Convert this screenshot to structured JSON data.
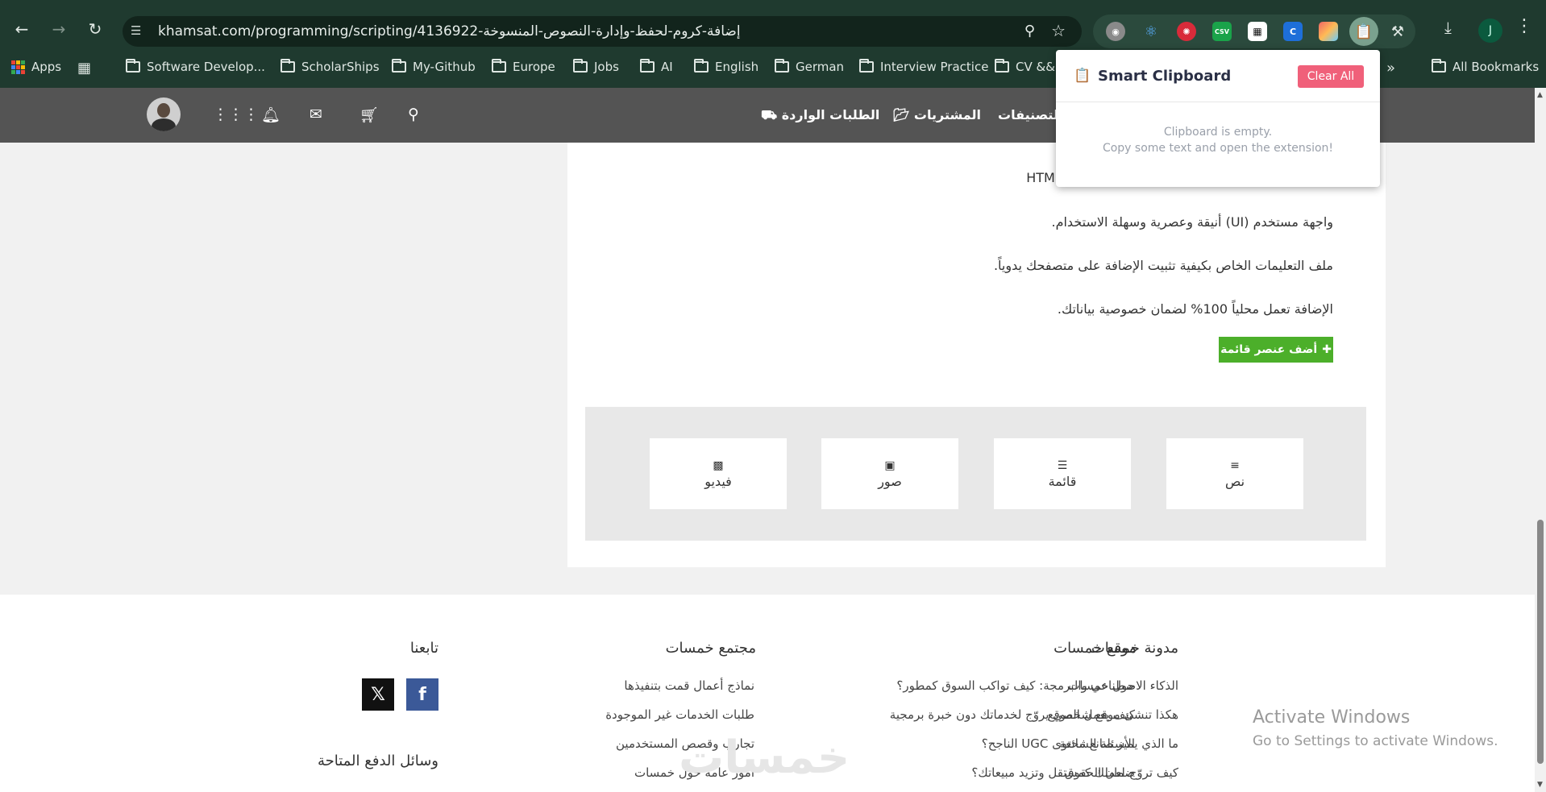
{
  "browser": {
    "url": "khamsat.com/programming/scripting/4136922-إضافة-كروم-لحفظ-وإدارة-النصوص-المنسوخة",
    "profile_initial": "J",
    "bookmarks": [
      {
        "label": "Apps"
      },
      {
        "label": "Software Develop..."
      },
      {
        "label": "ScholarShips"
      },
      {
        "label": "My-Github"
      },
      {
        "label": "Europe"
      },
      {
        "label": "Jobs"
      },
      {
        "label": "AI"
      },
      {
        "label": "English"
      },
      {
        "label": "German"
      },
      {
        "label": "Interview Practice"
      },
      {
        "label": "CV &&"
      }
    ],
    "all_bookmarks": "All Bookmarks",
    "overflow": "»"
  },
  "popup": {
    "title": "Smart Clipboard",
    "clear_label": "Clear All",
    "empty_line1": "Clipboard is empty.",
    "empty_line2": "Copy some text and open the extension!"
  },
  "sitenav": {
    "incoming_orders": "الطلبات الواردة",
    "purchases": "المشتريات",
    "categories": "التصنيفات"
  },
  "content": {
    "partial_line": "(HTML",
    "lines": [
      "واجهة مستخدم (UI) أنيقة وعصرية وسهلة الاستخدام.",
      "ملف التعليمات الخاص بكيفية تثبيت الإضافة على متصفحك يدوياً.",
      "الإضافة تعمل محلياً 100% لضمان خصوصية بياناتك."
    ],
    "add_list_item": "أضف عنصر قائمة",
    "blocks": [
      {
        "label": "نص",
        "icon": "text-align-icon"
      },
      {
        "label": "قائمة",
        "icon": "list-icon"
      },
      {
        "label": "صور",
        "icon": "image-icon"
      },
      {
        "label": "فيديو",
        "icon": "video-file-icon"
      }
    ]
  },
  "footer": {
    "site_title": "موقع خمسات",
    "site_links": [
      "حول خمسات",
      "كيف يعمل الموقع",
      "الأسئلة الشائعة",
      "ضمان الحقوق"
    ],
    "blog_title": "مدونة خمسات",
    "blog_links": [
      "الذكاء الاصطناعي والبرمجة: كيف تواكب السوق كمطور؟",
      "هكذا تنشئ موقع شخصي يروّج لخدماتك دون خبرة برمجية",
      "ما الذي يميز صانع محتوى UGC الناجح؟",
      "كيف تروّج لعملك كمستقل وتزيد مبيعاتك؟"
    ],
    "community_title": "مجتمع خمسات",
    "community_links": [
      "نماذج أعمال قمت بتنفيذها",
      "طلبات الخدمات غير الموجودة",
      "تجارب وقصص المستخدمين",
      "أمور عامة حول خمسات"
    ],
    "follow_title": "تابعنا",
    "payment_title": "وسائل الدفع المتاحة",
    "logo_text": "خمسات"
  },
  "windows": {
    "activate": "Activate Windows",
    "goto": "Go to Settings to activate Windows."
  },
  "colors": {
    "chrome_bg": "#1f3a2f",
    "site_nav": "#545454",
    "add_button": "#4caf2a",
    "clear_button": "#f0607a",
    "facebook": "#3b5998",
    "x": "#111111"
  }
}
